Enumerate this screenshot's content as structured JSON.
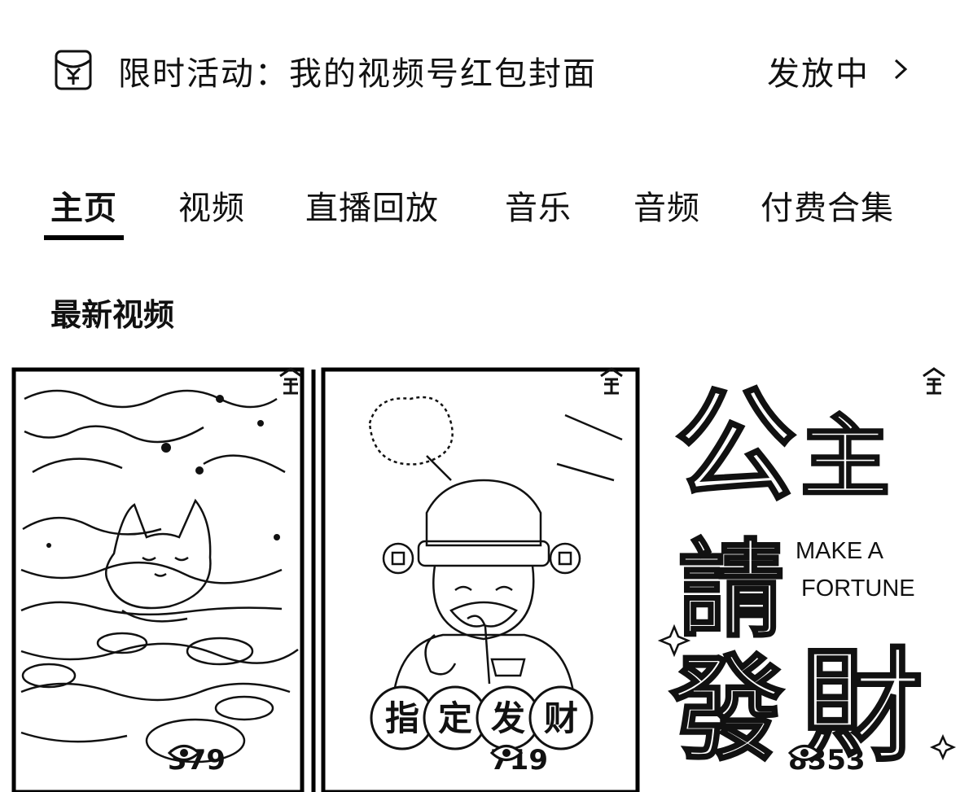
{
  "banner": {
    "icon": "red-packet-icon",
    "text": "限时活动：我的视频号红包封面",
    "status": "发放中",
    "chevron": "chevron-right-icon"
  },
  "tabs": [
    {
      "label": "主页",
      "active": true
    },
    {
      "label": "视频",
      "active": false
    },
    {
      "label": "直播回放",
      "active": false
    },
    {
      "label": "音乐",
      "active": false
    },
    {
      "label": "音频",
      "active": false
    },
    {
      "label": "付费合集",
      "active": false
    }
  ],
  "section": {
    "title": "最新视频"
  },
  "videos": [
    {
      "views": "379",
      "icon": "cat-in-water-thumbnail"
    },
    {
      "views": "719",
      "icon": "god-of-wealth-thumbnail",
      "caption_chars": [
        "指",
        "定",
        "发",
        "财"
      ]
    },
    {
      "views": "8353",
      "icon": "calligraphy-thumbnail",
      "caption_big": [
        "公",
        "主",
        "請",
        "發",
        "財"
      ],
      "caption_en_1": "MAKE A",
      "caption_en_2": "FORTUNE"
    }
  ]
}
